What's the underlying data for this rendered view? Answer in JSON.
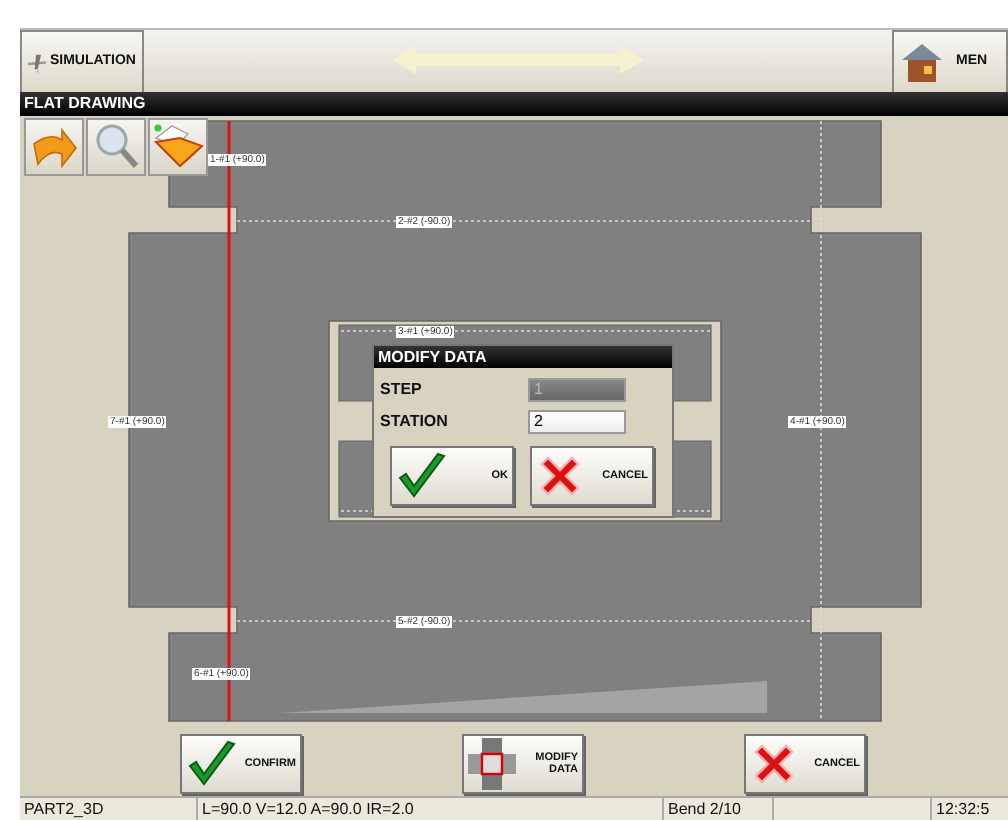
{
  "toolbar": {
    "simulation_button": {
      "label": "SIMULATION"
    },
    "menu_button": {
      "label": "MEN"
    }
  },
  "title": "FLAT DRAWING",
  "tools": [
    {
      "kind": "arrow"
    },
    {
      "kind": "zoom"
    },
    {
      "kind": "folder"
    }
  ],
  "drawing": {
    "bend_labels": [
      {
        "text": "1-#1 (+90.0)"
      },
      {
        "text": "2-#2 (-90.0)"
      },
      {
        "text": "3-#1 (+90.0)"
      },
      {
        "text": "7-#1 (+90.0)"
      },
      {
        "text": "4-#1 (+90.0)"
      },
      {
        "text": "5-#2 (-90.0)"
      },
      {
        "text": "6-#1 (+90.0)"
      }
    ]
  },
  "dialog": {
    "title": "MODIFY DATA",
    "fields": [
      {
        "label": "STEP",
        "value": "1",
        "disabled": true
      },
      {
        "label": "STATION",
        "value": "2",
        "disabled": false
      }
    ],
    "buttons": [
      {
        "label": "OK",
        "kind": "ok"
      },
      {
        "label": "CANCEL",
        "kind": "cancel"
      }
    ]
  },
  "actions": [
    {
      "label": "CONFIRM",
      "kind": "confirm"
    },
    {
      "label": "MODIFY DATA",
      "kind": "modify"
    },
    {
      "label": "CANCEL",
      "kind": "cancel"
    }
  ],
  "status_bar": [
    "PART2_3D",
    "L=90.0 V=12.0 A=90.0 IR=2.0",
    "Bend 2/10",
    "12:32:5"
  ]
}
